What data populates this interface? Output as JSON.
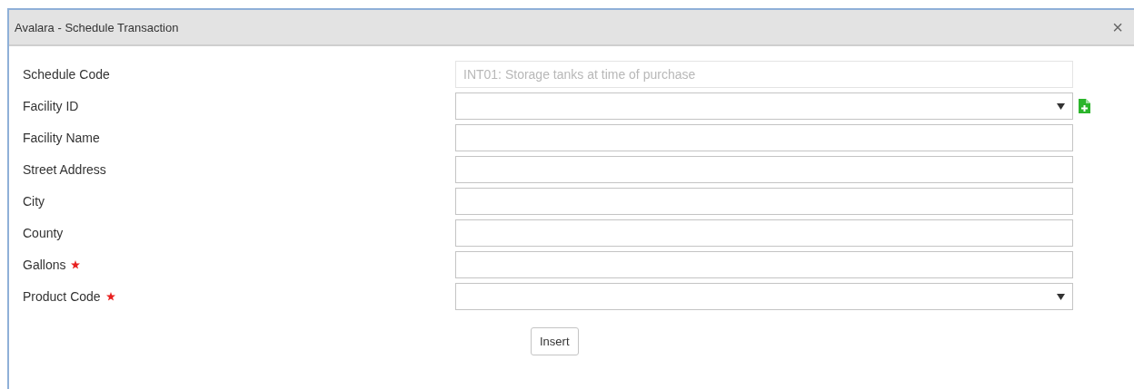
{
  "window": {
    "title": "Avalara - Schedule Transaction",
    "close": "×"
  },
  "fields": [
    {
      "label": "Schedule Code",
      "kind": "text",
      "required": false,
      "disabled": true,
      "value": "INT01: Storage tanks at time of purchase"
    },
    {
      "label": "Facility ID",
      "kind": "select",
      "required": false,
      "disabled": false,
      "add_button": true
    },
    {
      "label": "Facility Name",
      "kind": "text",
      "required": false,
      "disabled": false
    },
    {
      "label": "Street Address",
      "kind": "text",
      "required": false,
      "disabled": false
    },
    {
      "label": "City",
      "kind": "text",
      "required": false,
      "disabled": false
    },
    {
      "label": "County",
      "kind": "text",
      "required": false,
      "disabled": false
    },
    {
      "label": "Gallons",
      "kind": "text",
      "required": true,
      "disabled": false
    },
    {
      "label": "Product Code",
      "kind": "select",
      "required": true,
      "disabled": false
    }
  ],
  "buttons": [
    "Insert"
  ]
}
